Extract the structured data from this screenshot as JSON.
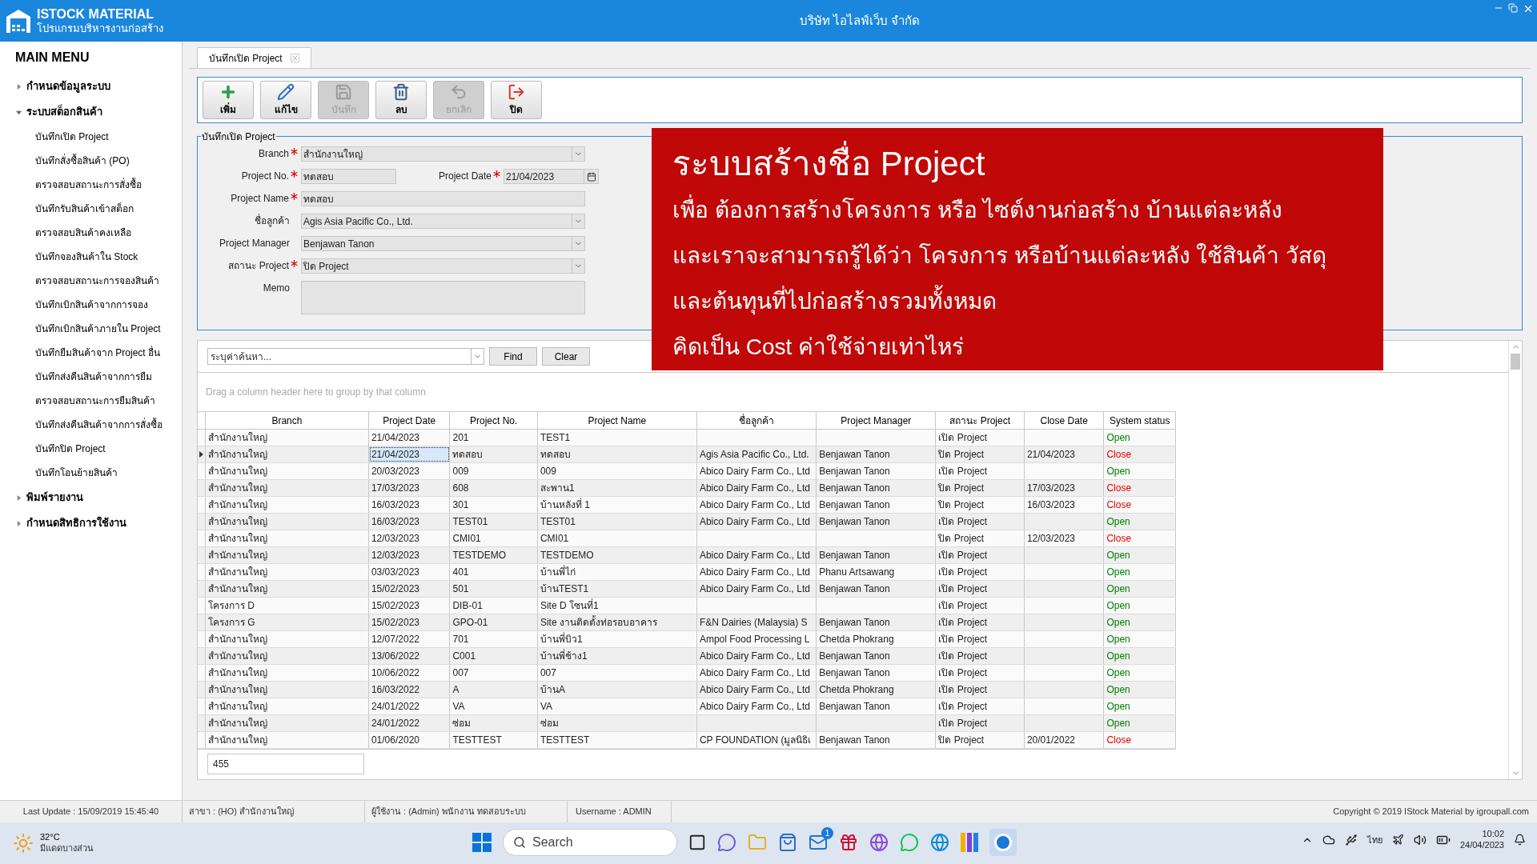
{
  "title_bar": {
    "app_name": "ISTOCK MATERIAL",
    "app_subtitle": "โปรแกรมบริหารงานก่อสร้าง",
    "title": "บริษัท ไอไลฟ์เว็บ จำกัด"
  },
  "sidebar": {
    "heading": "MAIN MENU",
    "items": [
      {
        "label": "กำหนดข้อมูลระบบ",
        "expanded": false
      },
      {
        "label": "ระบบสต็อกสินค้า",
        "expanded": true,
        "children": [
          {
            "label": "บันทึกเปิด Project"
          },
          {
            "label": "บันทึกสั่งซื้อสินค้า (PO)"
          },
          {
            "label": "ตรวจสอบสถานะการสั่งซื้อ"
          },
          {
            "label": "บันทึกรับสินค้าเข้าสต็อก"
          },
          {
            "label": "ตรวจสอบสินค้าคงเหลือ"
          },
          {
            "label": "บันทึกจองสินค้าใน Stock"
          },
          {
            "label": "ตรวจสอบสถานะการจองสินค้า"
          },
          {
            "label": "บันทึกเบิกสินค้าจากการจอง"
          },
          {
            "label": "บันทึกเบิกสินค้าภายใน Project"
          },
          {
            "label": "บันทึกยืมสินค้าจาก Project อื่น"
          },
          {
            "label": "บันทึกส่งคืนสินค้าจากการยืม"
          },
          {
            "label": "ตรวจสอบสถานะการยืมสินค้า"
          },
          {
            "label": "บันทึกส่งคืนสินค้าจากการสั่งซื้อ"
          },
          {
            "label": "บันทึกปิด Project"
          },
          {
            "label": "บันทึกโอนย้ายสินค้า"
          }
        ]
      },
      {
        "label": "พิมพ์รายงาน",
        "expanded": false
      },
      {
        "label": "กำหนดสิทธิการใช้งาน",
        "expanded": false
      }
    ]
  },
  "tabs": [
    {
      "label": "บันทึกเปิด Project",
      "selected": true
    }
  ],
  "toolbar": [
    {
      "kind": "add",
      "label": "เพิ่ม",
      "disabled": false
    },
    {
      "kind": "edit",
      "label": "แก้ไข",
      "disabled": false
    },
    {
      "kind": "save",
      "label": "บันทึก",
      "disabled": true
    },
    {
      "kind": "delete",
      "label": "ลบ",
      "disabled": false
    },
    {
      "kind": "undo",
      "label": "ยกเลิก",
      "disabled": true
    },
    {
      "kind": "close",
      "label": "ปิด",
      "disabled": false
    }
  ],
  "form": {
    "legend": "บันทึกเปิด Project",
    "rows": [
      [
        {
          "label": "Branch",
          "required": true,
          "kind": "select",
          "value": "สำนักงานใหญ่"
        }
      ],
      [
        {
          "label": "Project No.",
          "required": true,
          "kind": "text",
          "value": "ทดสอบ"
        },
        {
          "label": "Project Date",
          "required": true,
          "kind": "date",
          "value": "21/04/2023"
        }
      ],
      [
        {
          "label": "Project Name",
          "required": true,
          "kind": "text",
          "value": "ทดสอบ"
        }
      ],
      [
        {
          "label": "ชื่อลูกค้า",
          "required": false,
          "kind": "select",
          "value": "Agis Asia Pacific Co., Ltd."
        }
      ],
      [
        {
          "label": "Project Manager",
          "required": false,
          "kind": "select",
          "value": "Benjawan Tanon"
        }
      ],
      [
        {
          "label": "สถานะ Project",
          "required": true,
          "kind": "select",
          "value": "ปิด Project"
        }
      ],
      [
        {
          "label": "Memo",
          "required": false,
          "kind": "textarea"
        }
      ]
    ]
  },
  "banner": {
    "title": "ระบบสร้างชื่อ Project",
    "lines": [
      "เพื่อ ต้องการสร้างโครงการ หรือ ไซต์งานก่อสร้าง บ้านแต่ละหลัง",
      "และเราจะสามารถรู้ได้ว่า โครงการ หรือบ้านแต่ละหลัง ใช้สินค้า วัสดุ",
      "และต้นทุนที่ไปก่อสร้างรวมทั้งหมด",
      "คิดเป็น Cost ค่าใช้จ่ายเท่าไหร่"
    ]
  },
  "grid": {
    "search": {
      "placeholder": "ระบุค่าค้นหา..."
    },
    "buttons": [
      "Find",
      "Clear"
    ],
    "group_hint": "Drag a column header here to group by that column",
    "columns": [
      "Branch",
      "Project Date",
      "Project No.",
      "Project Name",
      "ชื่อลูกค้า",
      "Project Manager",
      "สถานะ Project",
      "Close Date",
      "System status"
    ],
    "rows": [
      {
        "selected": false,
        "branch": "สำนักงานใหญ่",
        "project_date": "21/04/2023",
        "project_no": "201",
        "project_name": "TEST1",
        "project_status": "เปิด Project",
        "system_status": "Open",
        "color": "#008000"
      },
      {
        "selected": true,
        "branch": "สำนักงานใหญ่",
        "project_date": "21/04/2023",
        "project_no": "ทดสอบ",
        "project_name": "ทดสอบ",
        "customer": "Agis Asia Pacific Co., Ltd.",
        "manager": "Benjawan Tanon",
        "project_status": "ปิด Project",
        "close_date": "21/04/2023",
        "system_status": "Close",
        "color": "#e00000"
      },
      {
        "selected": false,
        "branch": "สำนักงานใหญ่",
        "project_date": "20/03/2023",
        "project_no": "009",
        "project_name": "009",
        "customer": "Abico Dairy Farm Co., Ltd",
        "manager": "Benjawan Tanon",
        "project_status": "เปิด Project",
        "system_status": "Open",
        "color": "#008000"
      },
      {
        "selected": false,
        "branch": "สำนักงานใหญ่",
        "project_date": "17/03/2023",
        "project_no": "608",
        "project_name": "สะพาน1",
        "customer": "Abico Dairy Farm Co., Ltd",
        "manager": "Benjawan Tanon",
        "project_status": "ปิด Project",
        "close_date": "17/03/2023",
        "system_status": "Close",
        "color": "#e00000"
      },
      {
        "selected": false,
        "branch": "สำนักงานใหญ่",
        "project_date": "16/03/2023",
        "project_no": "301",
        "project_name": "บ้านหลังที่ 1",
        "customer": "Abico Dairy Farm Co., Ltd",
        "manager": "Benjawan Tanon",
        "project_status": "ปิด Project",
        "close_date": "16/03/2023",
        "system_status": "Close",
        "color": "#e00000"
      },
      {
        "selected": false,
        "branch": "สำนักงานใหญ่",
        "project_date": "16/03/2023",
        "project_no": "TEST01",
        "project_name": "TEST01",
        "customer": "Abico Dairy Farm Co., Ltd",
        "manager": "Benjawan Tanon",
        "project_status": "เปิด Project",
        "system_status": "Open",
        "color": "#008000"
      },
      {
        "selected": false,
        "branch": "สำนักงานใหญ่",
        "project_date": "12/03/2023",
        "project_no": "CMI01",
        "project_name": "CMI01",
        "project_status": "ปิด Project",
        "close_date": "12/03/2023",
        "system_status": "Close",
        "color": "#e00000"
      },
      {
        "selected": false,
        "branch": "สำนักงานใหญ่",
        "project_date": "12/03/2023",
        "project_no": "TESTDEMO",
        "project_name": "TESTDEMO",
        "customer": "Abico Dairy Farm Co., Ltd",
        "manager": "Benjawan Tanon",
        "project_status": "เปิด Project",
        "system_status": "Open",
        "color": "#008000"
      },
      {
        "selected": false,
        "branch": "สำนักงานใหญ่",
        "project_date": "03/03/2023",
        "project_no": "401",
        "project_name": "บ้านพี่ไก่",
        "customer": "Abico Dairy Farm Co., Ltd",
        "manager": "Phanu Artsawang",
        "project_status": "เปิด Project",
        "system_status": "Open",
        "color": "#008000"
      },
      {
        "selected": false,
        "branch": "สำนักงานใหญ่",
        "project_date": "15/02/2023",
        "project_no": "501",
        "project_name": "บ้านTEST1",
        "customer": "Abico Dairy Farm Co., Ltd",
        "manager": "Benjawan Tanon",
        "project_status": "เปิด Project",
        "system_status": "Open",
        "color": "#008000"
      },
      {
        "selected": false,
        "branch": "โครงการ D",
        "project_date": "15/02/2023",
        "project_no": "DIB-01",
        "project_name": "Site D โซนที่1",
        "project_status": "เปิด Project",
        "system_status": "Open",
        "color": "#008000"
      },
      {
        "selected": false,
        "branch": "โครงการ G",
        "project_date": "15/02/2023",
        "project_no": "GPO-01",
        "project_name": "Site งานติดตั้งท่อรอบอาคาร",
        "customer": "F&N Dairies (Malaysia) S",
        "manager": "Benjawan Tanon",
        "project_status": "เปิด Project",
        "system_status": "Open",
        "color": "#008000"
      },
      {
        "selected": false,
        "branch": "สำนักงานใหญ่",
        "project_date": "12/07/2022",
        "project_no": "701",
        "project_name": "บ้านพี่บิว1",
        "customer": "Ampol Food Processing L",
        "manager": "Chetda Phokrang",
        "project_status": "เปิด Project",
        "system_status": "Open",
        "color": "#008000"
      },
      {
        "selected": false,
        "branch": "สำนักงานใหญ่",
        "project_date": "13/06/2022",
        "project_no": "C001",
        "project_name": "บ้านพี่ช้าง1",
        "customer": "Abico Dairy Farm Co., Ltd",
        "manager": "Benjawan Tanon",
        "project_status": "เปิด Project",
        "system_status": "Open",
        "color": "#008000"
      },
      {
        "selected": false,
        "branch": "สำนักงานใหญ่",
        "project_date": "10/06/2022",
        "project_no": "007",
        "project_name": "007",
        "customer": "Abico Dairy Farm Co., Ltd",
        "manager": "Benjawan Tanon",
        "project_status": "เปิด Project",
        "system_status": "Open",
        "color": "#008000"
      },
      {
        "selected": false,
        "branch": "สำนักงานใหญ่",
        "project_date": "16/03/2022",
        "project_no": "A",
        "project_name": "บ้านA",
        "customer": "Abico Dairy Farm Co., Ltd",
        "manager": "Chetda Phokrang",
        "project_status": "เปิด Project",
        "system_status": "Open",
        "color": "#008000"
      },
      {
        "selected": false,
        "branch": "สำนักงานใหญ่",
        "project_date": "24/01/2022",
        "project_no": "VA",
        "project_name": "VA",
        "customer": "Abico Dairy Farm Co., Ltd",
        "manager": "Benjawan Tanon",
        "project_status": "เปิด Project",
        "system_status": "Open",
        "color": "#008000"
      },
      {
        "selected": false,
        "branch": "สำนักงานใหญ่",
        "project_date": "24/01/2022",
        "project_no": "ซ่อม",
        "project_name": "ซ่อม",
        "project_status": "เปิด Project",
        "system_status": "Open",
        "color": "#008000"
      },
      {
        "selected": false,
        "branch": "สำนักงานใหญ่",
        "project_date": "01/06/2020",
        "project_no": "TESTTEST",
        "project_name": "TESTTEST",
        "customer": "CP FOUNDATION (มูลนิธิเ",
        "manager": "Benjawan Tanon",
        "project_status": "ปิด Project",
        "close_date": "20/01/2022",
        "system_status": "Close",
        "color": "#e00000"
      }
    ],
    "footer_count": "455"
  },
  "status_bar": {
    "last_update": "Last Update : 15/09/2019 15:45:40",
    "branch": "สาขา : (HO) สำนักงานใหญ่",
    "user": "ผู้ใช้งาน : (Admin) พนักงาน ทดสอบระบบ",
    "username": "Username : ADMIN",
    "copyright": "Copyright © 2019 IStock Material by igroupall.com"
  },
  "taskbar": {
    "temperature": "32°C",
    "weather": "มีแดดบางส่วน",
    "search_placeholder": "Search",
    "mail_badge": "1",
    "language": "ไทย",
    "time": "10:02",
    "date": "24/04/2023"
  }
}
